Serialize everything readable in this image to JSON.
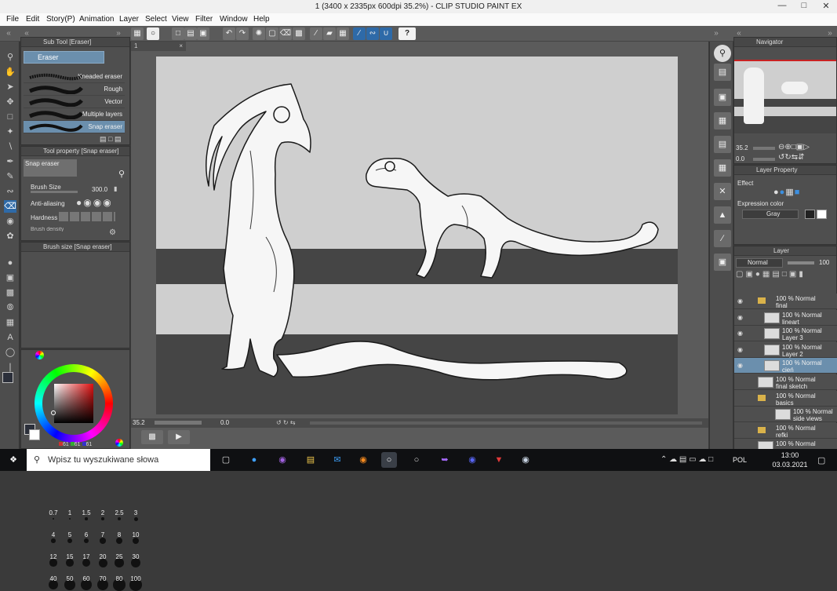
{
  "window": {
    "title": "1 (3400 x 2335px 600dpi 35.2%)  - CLIP STUDIO PAINT EX"
  },
  "menu": [
    "File",
    "Edit",
    "Story(P)",
    "Animation",
    "Layer",
    "Select",
    "View",
    "Filter",
    "Window",
    "Help"
  ],
  "subtool_panel": {
    "title": "Sub Tool [Eraser]",
    "group": "Eraser",
    "items": [
      "Kneaded eraser",
      "Rough",
      "Vector",
      "Multiple layers",
      "Snap eraser"
    ],
    "selected": "Snap eraser"
  },
  "tool_property": {
    "title": "Tool property [Snap eraser]",
    "preview_label": "Snap eraser",
    "brush_size_label": "Brush Size",
    "brush_size_value": "300.0",
    "anti_aliasing_label": "Anti-aliasing",
    "hardness_label": "Hardness",
    "brush_density_label": "Brush density"
  },
  "brush_size_panel": {
    "title": "Brush size [Snap eraser]",
    "sizes": [
      "0.7",
      "1",
      "1.5",
      "2",
      "2.5",
      "3",
      "4",
      "5",
      "6",
      "7",
      "8",
      "10",
      "12",
      "15",
      "17",
      "20",
      "25",
      "30",
      "40",
      "50",
      "60",
      "70",
      "80",
      "100"
    ]
  },
  "color": {
    "main": "#2b2f3a",
    "sub": "#ffffff",
    "values": [
      "61",
      "61",
      "61"
    ]
  },
  "canvas": {
    "tab_label": "1",
    "zoom": "35.2",
    "angle": "0.0"
  },
  "navigator": {
    "title": "Navigator",
    "zoom": "35.2",
    "angle": "0.0"
  },
  "layer_property": {
    "title": "Layer Property",
    "effect_label": "Effect",
    "expression_color_label": "Expression color",
    "expression_color_value": "Gray"
  },
  "layer_panel": {
    "title": "Layer",
    "blend_mode": "Normal",
    "opacity": "100",
    "layers": [
      {
        "top": "100 % Normal",
        "name": "final",
        "type": "folder"
      },
      {
        "top": "100 % Normal",
        "name": "lineart",
        "type": "layer"
      },
      {
        "top": "100 % Normal",
        "name": "Layer 3",
        "type": "layer"
      },
      {
        "top": "100 % Normal",
        "name": "Layer 2",
        "type": "layer"
      },
      {
        "top": "100 % Normal",
        "name": "cień",
        "type": "layer",
        "selected": true
      },
      {
        "top": "100 % Normal",
        "name": "final sketch",
        "type": "layer"
      },
      {
        "top": "100 % Normal",
        "name": "basics",
        "type": "folder"
      },
      {
        "top": "100 % Normal",
        "name": "side views",
        "type": "layer"
      },
      {
        "top": "100 % Normal",
        "name": "refki",
        "type": "folder"
      },
      {
        "top": "100 % Normal",
        "name": "",
        "type": "layer"
      }
    ]
  },
  "taskbar": {
    "search_placeholder": "Wpisz tu wyszukiwane słowa",
    "language": "POL",
    "time": "13:00",
    "date": "03.03.2021"
  },
  "colors": {
    "accent": "#2e6aa8",
    "selected_layer": "#6b8fad",
    "panel": "#4f4f4f"
  }
}
